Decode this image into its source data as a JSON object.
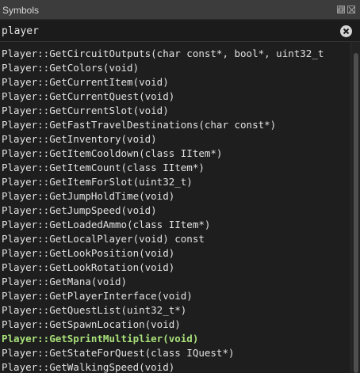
{
  "window": {
    "title": "Symbols"
  },
  "search": {
    "value": "player"
  },
  "results": [
    "Player::GetCircuitOutputs(char const*, bool*, uint32_t",
    "Player::GetColors(void)",
    "Player::GetCurrentItem(void)",
    "Player::GetCurrentQuest(void)",
    "Player::GetCurrentSlot(void)",
    "Player::GetFastTravelDestinations(char const*)",
    "Player::GetInventory(void)",
    "Player::GetItemCooldown(class IItem*)",
    "Player::GetItemCount(class IItem*)",
    "Player::GetItemForSlot(uint32_t)",
    "Player::GetJumpHoldTime(void)",
    "Player::GetJumpSpeed(void)",
    "Player::GetLoadedAmmo(class IItem*)",
    "Player::GetLocalPlayer(void) const",
    "Player::GetLookPosition(void)",
    "Player::GetLookRotation(void)",
    "Player::GetMana(void)",
    "Player::GetPlayerInterface(void)",
    "Player::GetQuestList(uint32_t*)",
    "Player::GetSpawnLocation(void)",
    "Player::GetSprintMultiplier(void)",
    "Player::GetStateForQuest(class IQuest*)",
    "Player::GetWalkingSpeed(void)"
  ],
  "selected_index": 20,
  "colors": {
    "selected_text": "#a8e07a",
    "text": "#e2e2e2",
    "background": "#1e1e1e"
  },
  "icons": {
    "restore": "restore-icon",
    "close": "close-icon",
    "clear": "clear-search-icon"
  }
}
